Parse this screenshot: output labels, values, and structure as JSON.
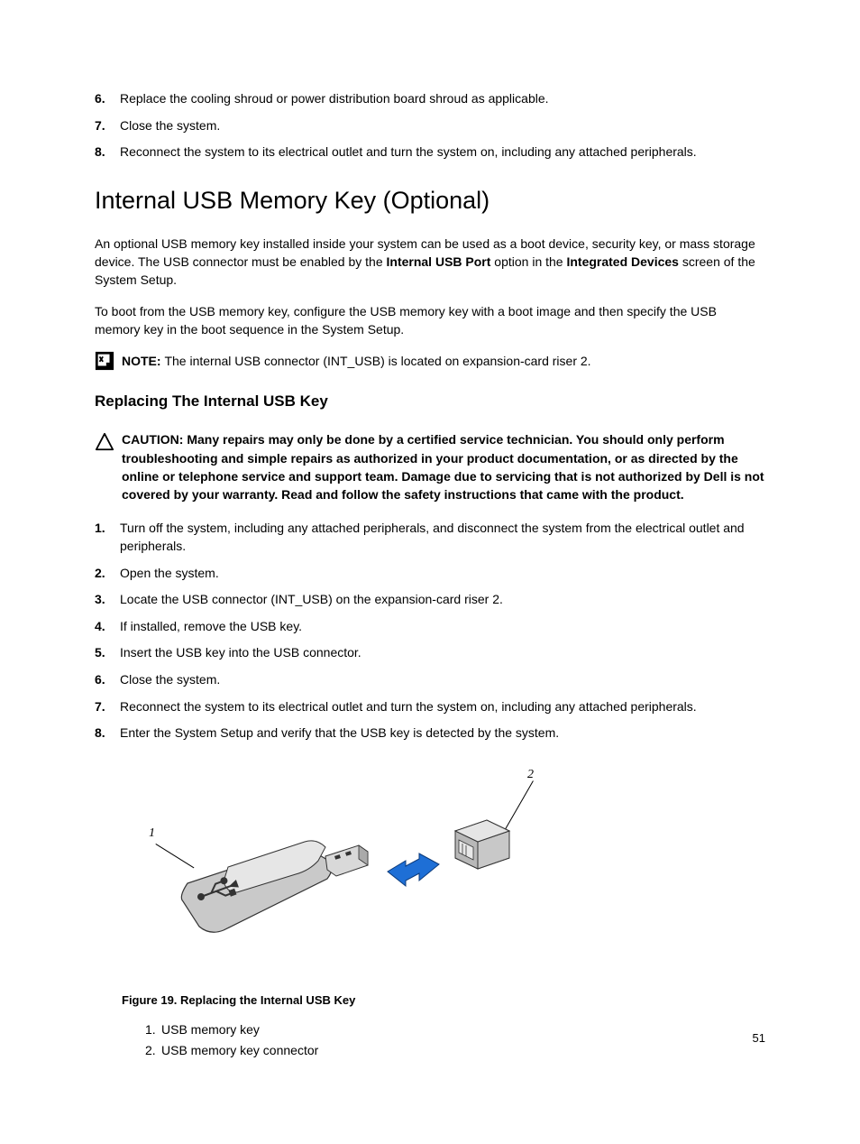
{
  "top_steps": [
    {
      "num": "6.",
      "text": "Replace the cooling shroud or power distribution board shroud as applicable."
    },
    {
      "num": "7.",
      "text": "Close the system."
    },
    {
      "num": "8.",
      "text": "Reconnect the system to its electrical outlet and turn the system on, including any attached peripherals."
    }
  ],
  "heading1": "Internal USB Memory Key (Optional)",
  "para1_pre": "An optional USB memory key installed inside your system can be used as a boot device, security key, or mass storage device. The USB connector must be enabled by the ",
  "para1_b1": "Internal USB Port",
  "para1_mid": " option in the ",
  "para1_b2": "Integrated Devices",
  "para1_post": " screen of the System Setup.",
  "para2": "To boot from the USB memory key, configure the USB memory key with a boot image and then specify the USB memory key in the boot sequence in the System Setup.",
  "note_label": "NOTE: ",
  "note_text": "The internal USB connector (INT_USB) is located on expansion-card riser 2.",
  "heading2": "Replacing The Internal USB Key",
  "caution_label": "CAUTION: ",
  "caution_text": "Many repairs may only be done by a certified service technician. You should only perform troubleshooting and simple repairs as authorized in your product documentation, or as directed by the online or telephone service and support team. Damage due to servicing that is not authorized by Dell is not covered by your warranty. Read and follow the safety instructions that came with the product.",
  "steps2": [
    {
      "num": "1.",
      "text": "Turn off the system, including any attached peripherals, and disconnect the system from the electrical outlet and peripherals."
    },
    {
      "num": "2.",
      "text": "Open the system."
    },
    {
      "num": "3.",
      "text": "Locate the USB connector (INT_USB) on the expansion-card riser 2."
    },
    {
      "num": "4.",
      "text": "If installed, remove the USB key."
    },
    {
      "num": "5.",
      "text": "Insert the USB key into the USB connector."
    },
    {
      "num": "6.",
      "text": "Close the system."
    },
    {
      "num": "7.",
      "text": "Reconnect the system to its electrical outlet and turn the system on, including any attached peripherals."
    },
    {
      "num": "8.",
      "text": "Enter the System Setup and verify that the USB key is detected by the system."
    }
  ],
  "fig_label_1": "1",
  "fig_label_2": "2",
  "figure_caption": "Figure 19. Replacing the Internal USB Key",
  "legend": [
    {
      "num": "1.",
      "text": "USB memory key"
    },
    {
      "num": "2.",
      "text": "USB memory key connector"
    }
  ],
  "page_number": "51"
}
